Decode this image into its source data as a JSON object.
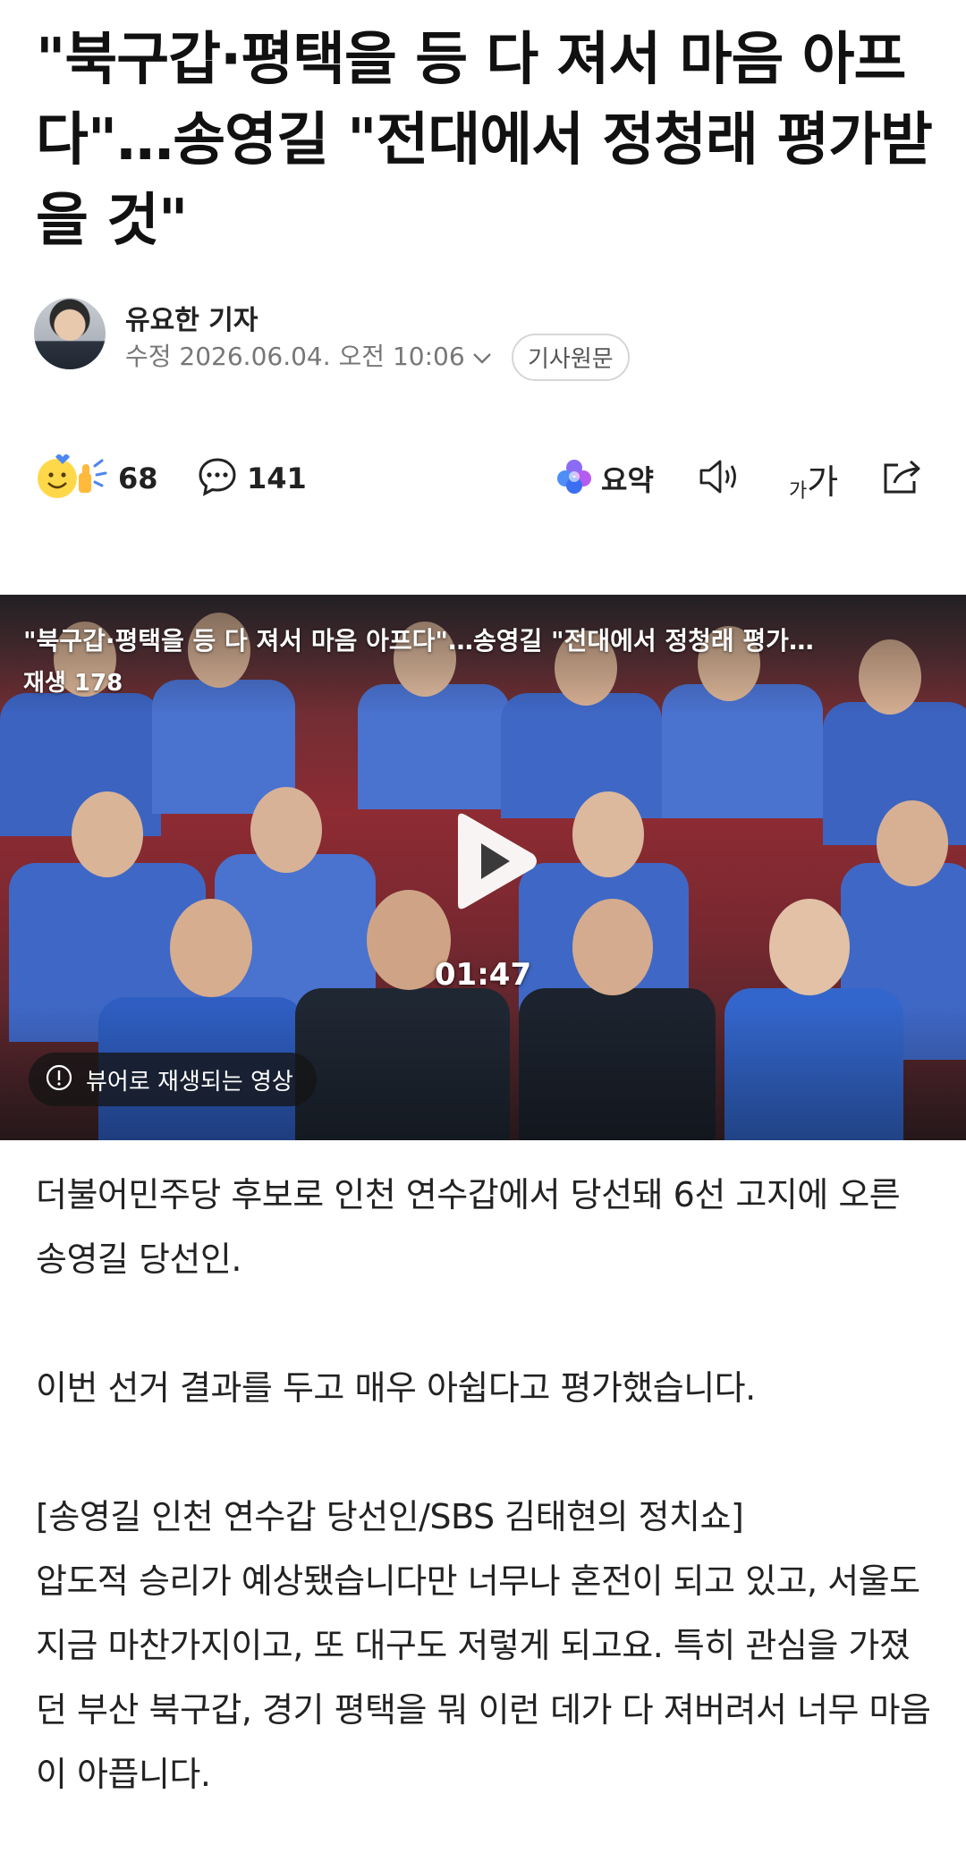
{
  "article": {
    "headline": "\"북구갑·평택을 등 다 져서 마음 아프다\"…송영길 \"전대에서 정청래 평가받을 것\"",
    "reporter": "유요한 기자",
    "date": "수정 2026.06.04. 오전 10:06",
    "original_button": "기사원문"
  },
  "toolbar": {
    "reactions_count": "68",
    "comments_count": "141",
    "summary_label": "요약",
    "font_size_label_small": "가",
    "font_size_label_large": "가",
    "icons": [
      "reaction-emoji-icon",
      "comment-icon",
      "ai-summary-icon",
      "speaker-icon",
      "font-size-icon",
      "share-icon"
    ]
  },
  "video": {
    "title": "\"북구갑·평택을 등 다 져서 마음 아프다\"…송영길 \"전대에서 정청래 평가…",
    "views": "재생 178",
    "duration": "01:47",
    "viewer_notice": "뷰어로 재생되는 영상"
  },
  "body": {
    "paragraphs": [
      "더불어민주당 후보로 인천 연수갑에서 당선돼 6선 고지에 오른 송영길 당선인.",
      "이번 선거 결과를 두고 매우 아쉽다고 평가했습니다.",
      "[송영길 인천 연수갑 당선인/SBS 김태현의 정치쇼]\n압도적 승리가 예상됐습니다만 너무나 혼전이 되고 있고, 서울도 지금 마찬가지이고, 또 대구도 저렇게 되고요. 특히 관심을 가졌던 부산 북구갑, 경기 평택을 뭐 이런 데가 다 져버려서 너무 마음이 아픕니다."
    ]
  },
  "colors": {
    "accent_blue": "#3a63c9",
    "text_dark": "#111111",
    "text_gray": "#777777"
  }
}
